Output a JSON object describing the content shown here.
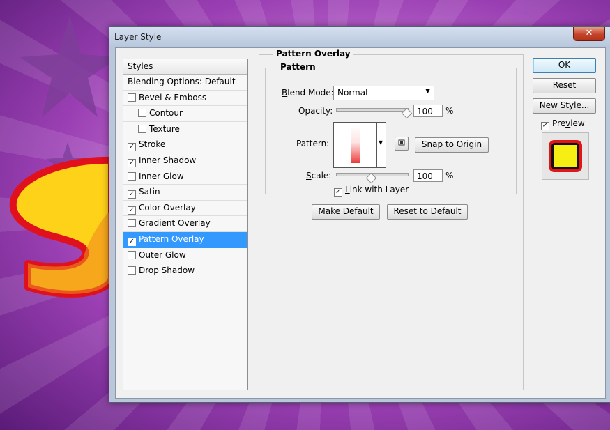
{
  "dialog": {
    "title": "Layer Style",
    "close_glyph": "✕"
  },
  "styles_panel": {
    "header": "Styles",
    "items": [
      {
        "label": "Blending Options: Default",
        "checkbox": false,
        "checked": false
      },
      {
        "label": "Bevel & Emboss",
        "checkbox": true,
        "checked": false
      },
      {
        "label": "Contour",
        "checkbox": true,
        "checked": false,
        "indent": true
      },
      {
        "label": "Texture",
        "checkbox": true,
        "checked": false,
        "indent": true
      },
      {
        "label": "Stroke",
        "checkbox": true,
        "checked": true
      },
      {
        "label": "Inner Shadow",
        "checkbox": true,
        "checked": true
      },
      {
        "label": "Inner Glow",
        "checkbox": true,
        "checked": false
      },
      {
        "label": "Satin",
        "checkbox": true,
        "checked": true
      },
      {
        "label": "Color Overlay",
        "checkbox": true,
        "checked": true
      },
      {
        "label": "Gradient Overlay",
        "checkbox": true,
        "checked": false
      },
      {
        "label": "Pattern Overlay",
        "checkbox": true,
        "checked": true,
        "selected": true
      },
      {
        "label": "Outer Glow",
        "checkbox": true,
        "checked": false
      },
      {
        "label": "Drop Shadow",
        "checkbox": true,
        "checked": false
      }
    ]
  },
  "pattern_overlay": {
    "section_title": "Pattern Overlay",
    "group_title": "Pattern",
    "blend_mode_label_u": "B",
    "blend_mode_label_rest": "lend Mode:",
    "blend_mode_value": "Normal",
    "opacity_label": "Opacity:",
    "opacity_value": "100",
    "opacity_percent": 1.0,
    "percent_sign": "%",
    "pattern_label": "Pattern:",
    "snap_label_pre": "S",
    "snap_label_u": "n",
    "snap_label_post": "ap to Origin",
    "scale_label_u": "S",
    "scale_label_rest": "cale:",
    "scale_value": "100",
    "scale_fraction": 0.5,
    "link_checked": true,
    "link_label_u": "L",
    "link_label_rest": "ink with Layer",
    "make_default": "Make Default",
    "reset_default": "Reset to Default"
  },
  "buttons": {
    "ok": "OK",
    "reset": "Reset",
    "new_style_pre": "Ne",
    "new_style_u": "w",
    "new_style_post": " Style...",
    "preview_checked": true,
    "preview_pre": "Pre",
    "preview_u": "v",
    "preview_post": "iew"
  },
  "colors": {
    "selection": "#3399ff",
    "preview_fill": "#f7ee14",
    "preview_stroke": "#e31414"
  }
}
